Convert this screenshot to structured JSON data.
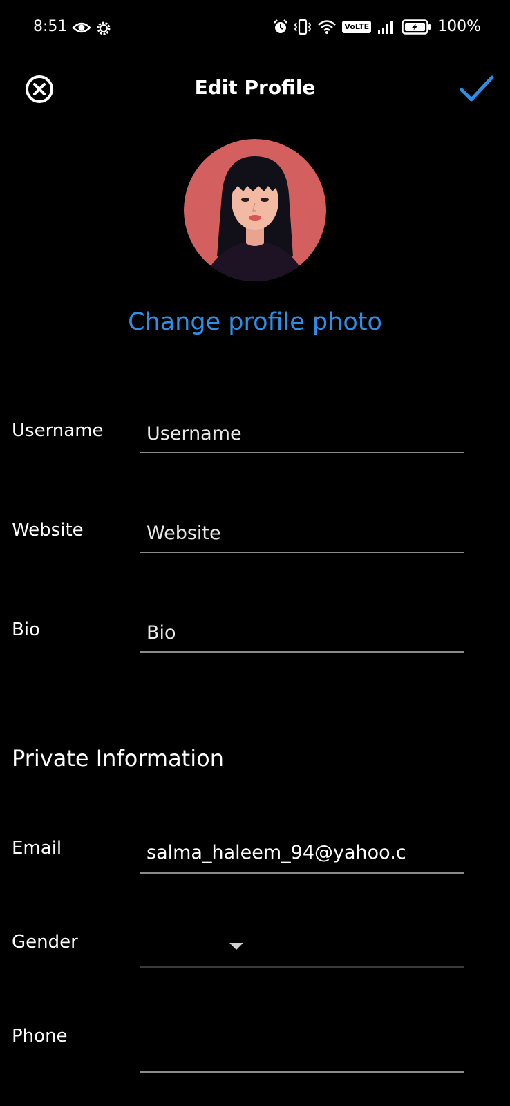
{
  "status_bar": {
    "time": "8:51",
    "left_icons": [
      "eye-icon",
      "settings-gear-icon"
    ],
    "right_icons": [
      "alarm-icon",
      "vibrate-icon",
      "wifi-icon",
      "volte-icon",
      "signal-icon",
      "battery-charging-icon"
    ],
    "volte_label": "VoLTE",
    "battery": "100%"
  },
  "header": {
    "title": "Edit Profile",
    "close_icon": "close-circle-icon",
    "confirm_icon": "checkmark-icon",
    "accent_color": "#2d8ee6"
  },
  "profile": {
    "avatar_icon": "woman-avatar-illustration",
    "change_photo_label": "Change profile photo"
  },
  "public_fields": [
    {
      "label": "Username",
      "placeholder": "Username",
      "value": ""
    },
    {
      "label": "Website",
      "placeholder": "Website",
      "value": ""
    },
    {
      "label": "Bio",
      "placeholder": "Bio",
      "value": ""
    }
  ],
  "private_section": {
    "title": "Private Information",
    "email": {
      "label": "Email",
      "value": "salma_haleem_94@yahoo.c"
    },
    "gender": {
      "label": "Gender",
      "value": "",
      "icon": "dropdown-arrow-icon"
    },
    "phone": {
      "label": "Phone",
      "value": ""
    }
  }
}
